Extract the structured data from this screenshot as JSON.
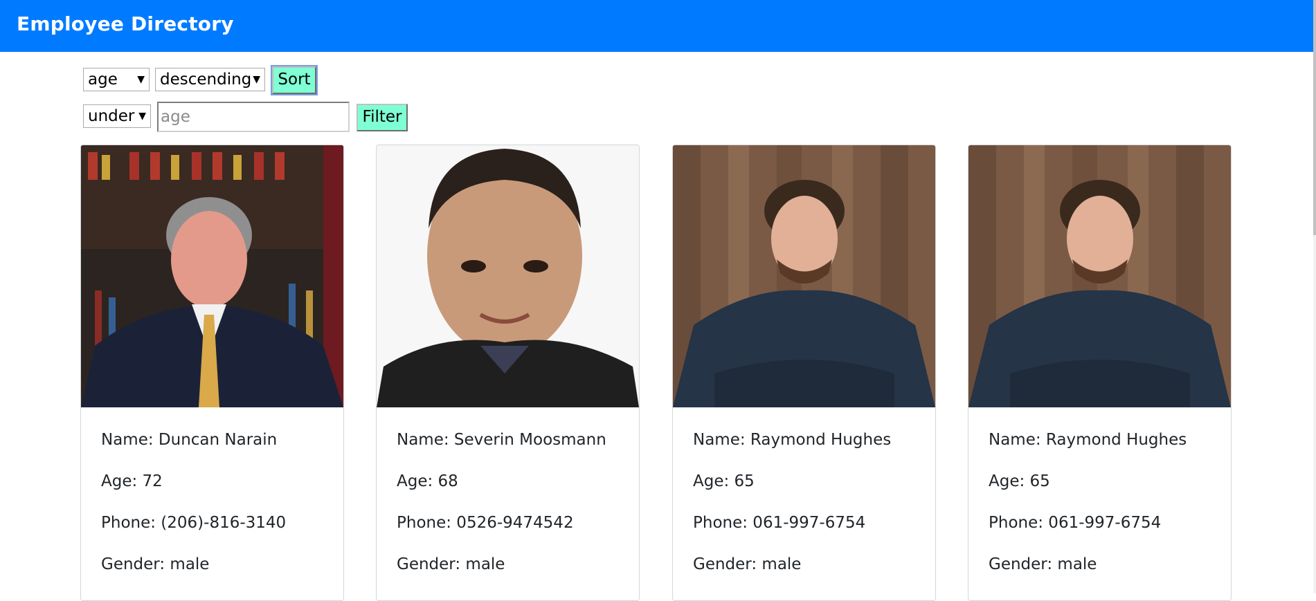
{
  "header": {
    "title": "Employee Directory"
  },
  "controls": {
    "sort_field": "age",
    "sort_order": "descending",
    "sort_label": "Sort",
    "filter_operator": "under",
    "filter_placeholder": "age",
    "filter_value": "",
    "filter_label": "Filter"
  },
  "employees": [
    {
      "name": "Name: Duncan Narain",
      "age": "Age: 72",
      "phone": "Phone: (206)-816-3140",
      "gender": "Gender: male"
    },
    {
      "name": "Name: Severin Moosmann",
      "age": "Age: 68",
      "phone": "Phone: 0526-9474542",
      "gender": "Gender: male"
    },
    {
      "name": "Name: Raymond Hughes",
      "age": "Age: 65",
      "phone": "Phone: 061-997-6754",
      "gender": "Gender: male"
    },
    {
      "name": "Name: Raymond Hughes",
      "age": "Age: 65",
      "phone": "Phone: 061-997-6754",
      "gender": "Gender: male"
    }
  ],
  "colors": {
    "navbar": "#007bff",
    "button": "#7fffd4"
  }
}
